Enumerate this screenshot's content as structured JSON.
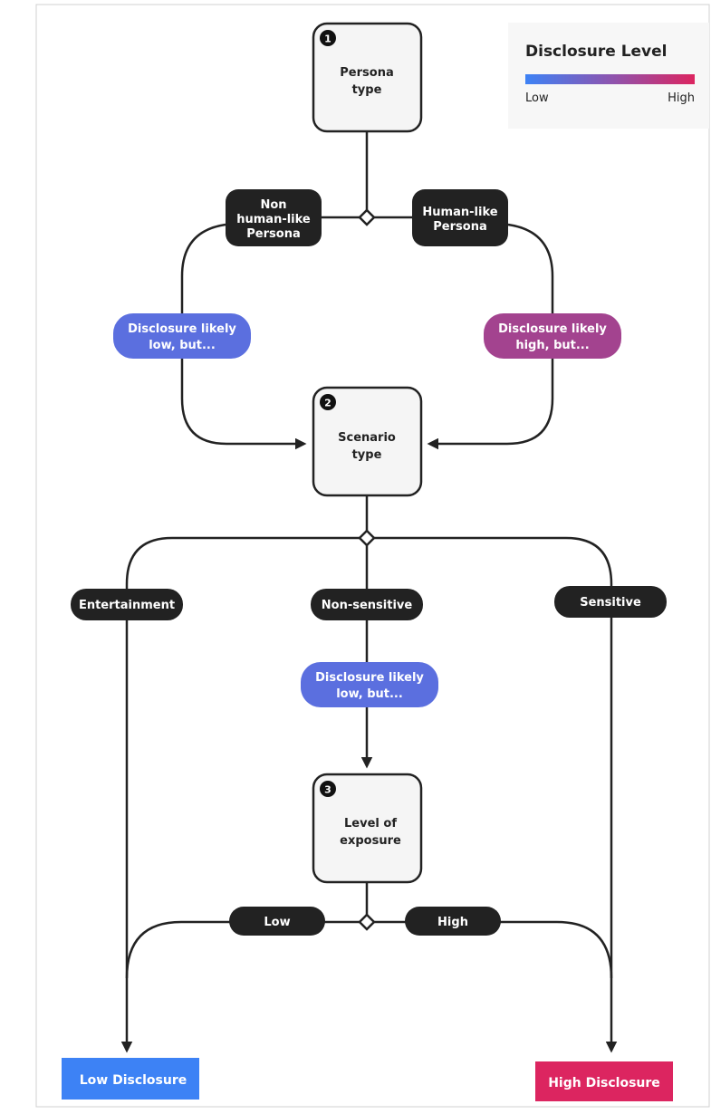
{
  "legend": {
    "title": "Disclosure Level",
    "low_label": "Low",
    "high_label": "High",
    "gradient_from": "#3d82f5",
    "gradient_to": "#dc2560"
  },
  "nodes": {
    "persona": {
      "step": "1",
      "line1": "Persona",
      "line2": "type"
    },
    "scenario": {
      "step": "2",
      "line1": "Scenario",
      "line2": "type"
    },
    "exposure": {
      "step": "3",
      "line1": "Level of",
      "line2": "exposure"
    }
  },
  "branches": {
    "non_human": {
      "line1": "Non",
      "line2": "human-like",
      "line3": "Persona"
    },
    "human": {
      "line1": "Human-like",
      "line2": "Persona"
    },
    "entertainment": "Entertainment",
    "non_sensitive": "Non-sensitive",
    "sensitive": "Sensitive",
    "low": "Low",
    "high": "High"
  },
  "notes": {
    "non_human_note": {
      "line1": "Disclosure likely",
      "line2": "low, but...",
      "color": "#5b6fdf"
    },
    "human_note": {
      "line1": "Disclosure likely",
      "line2": "high, but...",
      "color": "#a3438f"
    },
    "non_sensitive_note": {
      "line1": "Disclosure likely",
      "line2": "low, but...",
      "color": "#5b6fdf"
    }
  },
  "outcomes": {
    "low": {
      "label": "Low Disclosure",
      "color": "#3d82f5"
    },
    "high": {
      "label": "High Disclosure",
      "color": "#dc2560"
    }
  }
}
